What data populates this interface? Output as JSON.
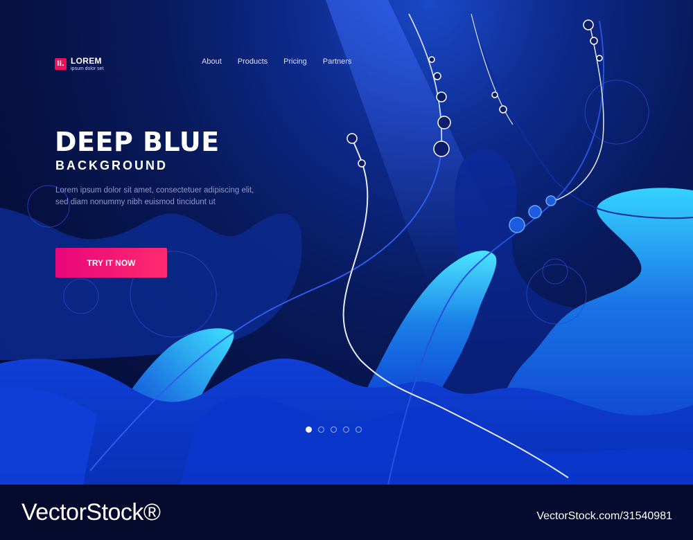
{
  "brand": {
    "mark": "li.",
    "name": "LOREM",
    "tagline": "ipsum dolor set"
  },
  "nav": {
    "items": [
      "About",
      "Products",
      "Pricing",
      "Partners"
    ]
  },
  "hero": {
    "title": "DEEP BLUE",
    "subtitle": "BACKGROUND",
    "description": "Lorem ipsum dolor sit amet, consectetuer adipiscing elit, sed diam nonummy nibh euismod tincidunt ut",
    "cta_label": "TRY IT NOW"
  },
  "pagination": {
    "count": 5,
    "active_index": 0
  },
  "watermark": {
    "brand": "VectorStock®",
    "id": "VectorStock.com/31540981"
  },
  "colors": {
    "background": "#061142",
    "accent": "#e8067b",
    "wave_light": "#22c4f0",
    "wave_dark": "#0a35c8"
  }
}
